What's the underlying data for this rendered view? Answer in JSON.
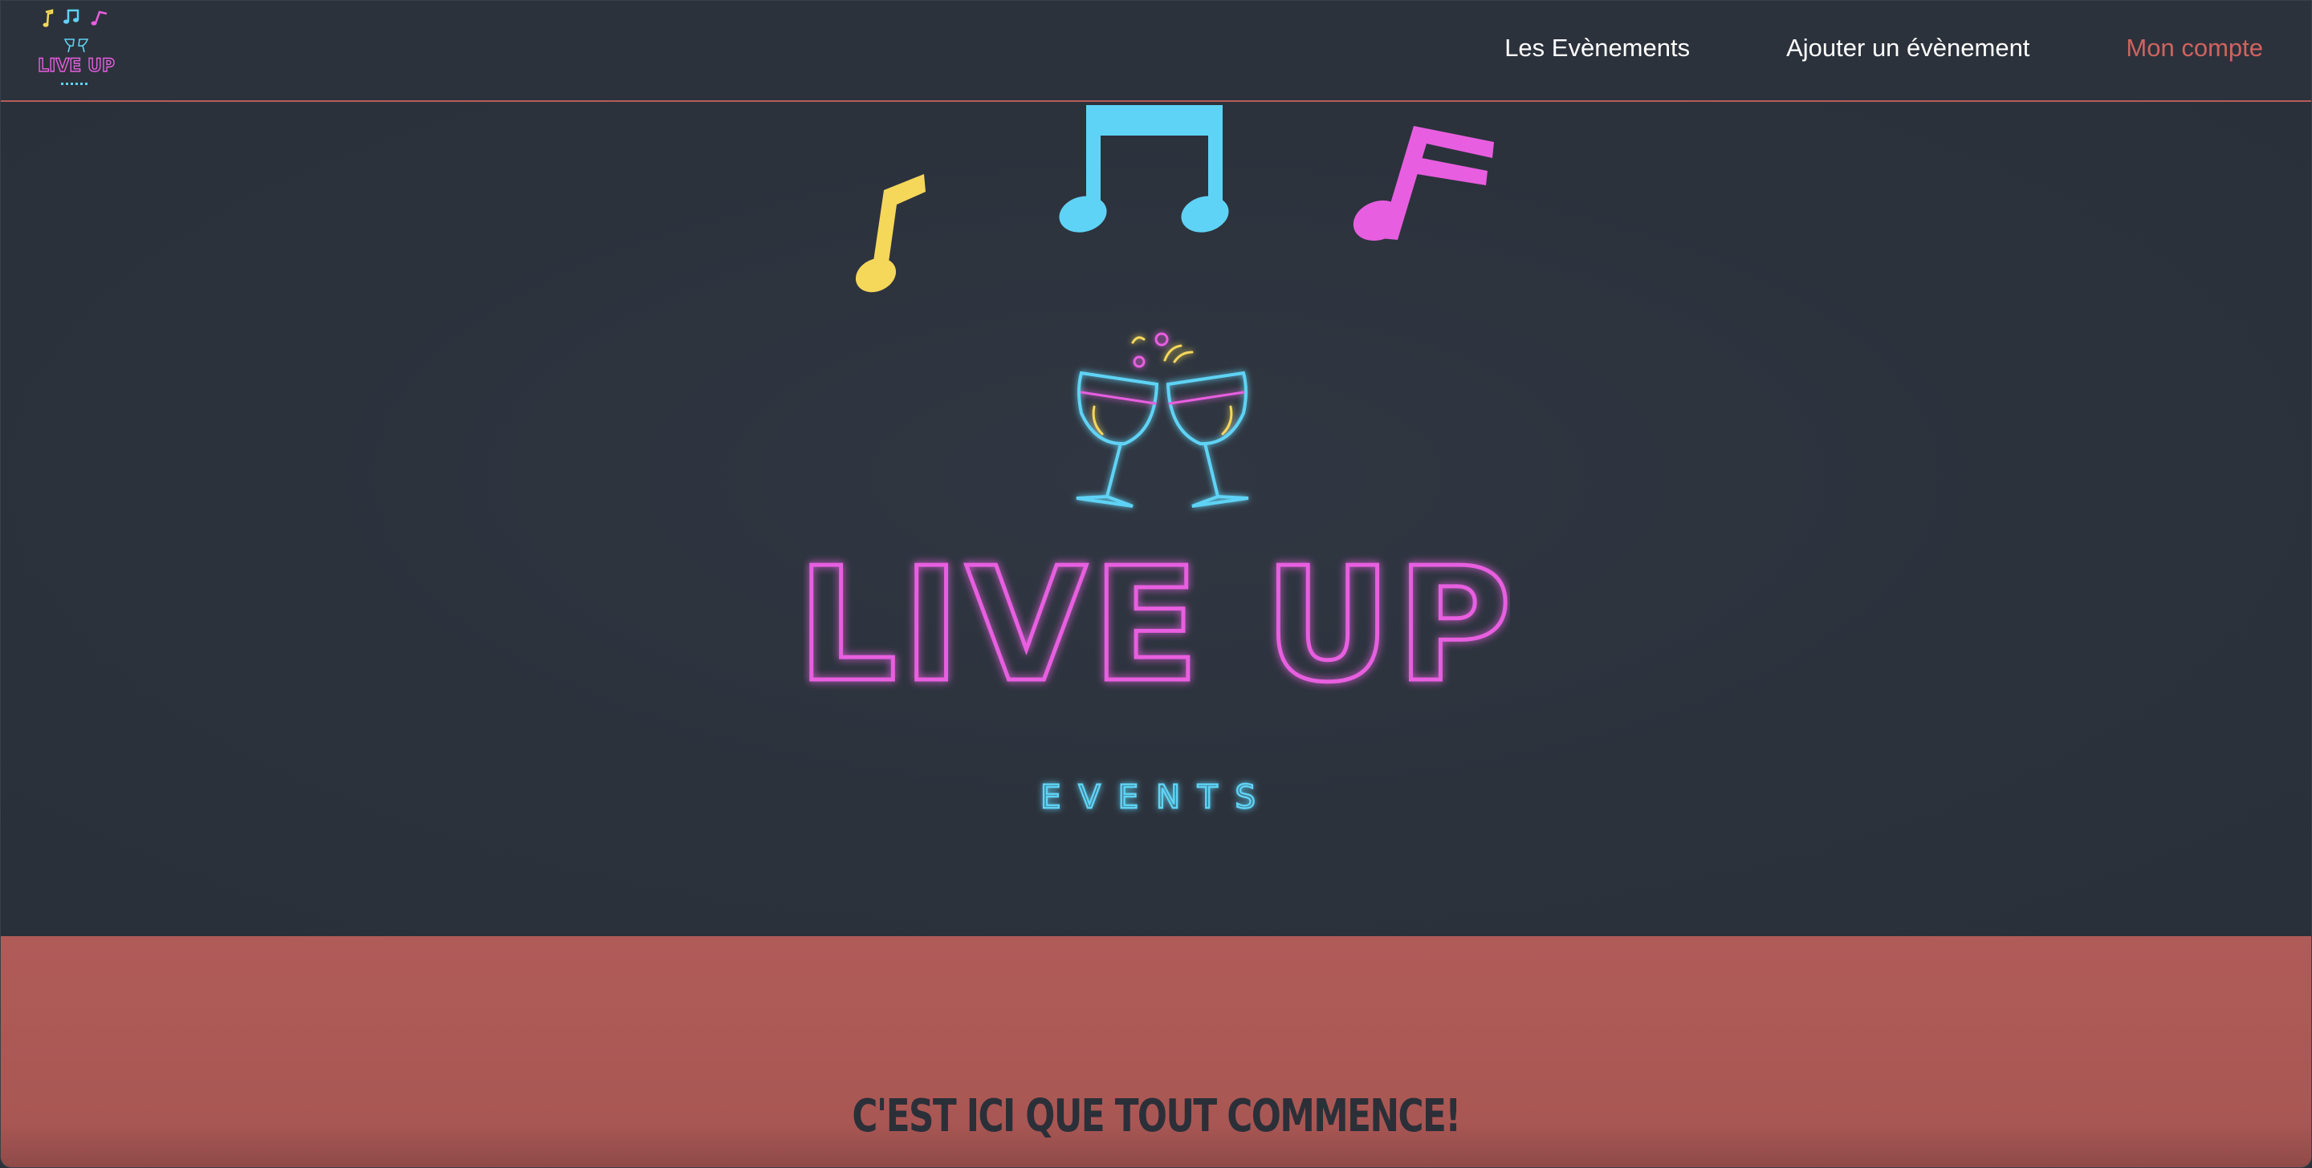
{
  "nav": {
    "logo_text": "LIVE UP",
    "logo_subtext": "EVENTS",
    "links": [
      {
        "label": "Les Evènements"
      },
      {
        "label": "Ajouter un évènement"
      },
      {
        "label": "Mon compte"
      }
    ]
  },
  "hero": {
    "brand_title": "LIVE UP",
    "brand_subtitle": "EVENTS",
    "icons": [
      "yellow-music-note-icon",
      "blue-double-note-icon",
      "pink-music-note-icon",
      "toasting-glasses-icon"
    ]
  },
  "band": {
    "tagline": "C'EST ICI QUE TOUT COMMENCE!"
  },
  "colors": {
    "background": "#2c323c",
    "accent": "#b05b58",
    "neon_pink": "#e85ee0",
    "neon_blue": "#5fd3f5",
    "neon_yellow": "#f5d75a"
  }
}
